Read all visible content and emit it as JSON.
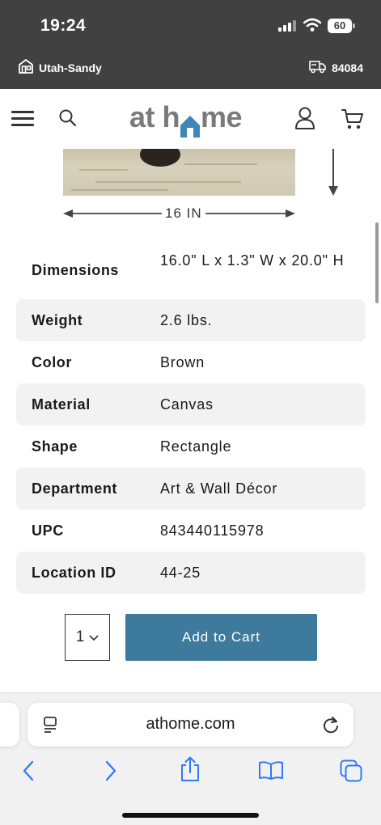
{
  "status_bar": {
    "time": "19:24",
    "battery": "60"
  },
  "store_bar": {
    "location": "Utah-Sandy",
    "zip": "84084"
  },
  "header": {
    "logo_left": "at h",
    "logo_right": "me"
  },
  "product_dims": {
    "width_label": "16 IN"
  },
  "specs": [
    {
      "key": "Dimensions",
      "value": "16.0\" L x 1.3\" W x 20.0\" H"
    },
    {
      "key": "Weight",
      "value": "2.6 lbs."
    },
    {
      "key": "Color",
      "value": "Brown"
    },
    {
      "key": "Material",
      "value": "Canvas"
    },
    {
      "key": "Shape",
      "value": "Rectangle"
    },
    {
      "key": "Department",
      "value": "Art & Wall Décor"
    },
    {
      "key": "UPC",
      "value": "843440115978"
    },
    {
      "key": "Location ID",
      "value": "44-25"
    }
  ],
  "purchase": {
    "quantity": "1",
    "add_to_cart_label": "Add to Cart",
    "button_color": "#3d7a9c"
  },
  "browser": {
    "url": "athome.com"
  },
  "icons": {
    "store": "storefront-icon",
    "delivery": "delivery-truck-icon",
    "menu": "hamburger-menu-icon",
    "search": "search-icon",
    "account": "account-icon",
    "cart": "cart-icon",
    "back": "back-icon",
    "forward": "forward-icon",
    "share": "share-icon",
    "bookmarks": "bookmarks-icon",
    "tabs": "tabs-icon"
  },
  "colors": {
    "top_bar": "#414141",
    "logo_gray": "#7a7a7a",
    "logo_house": "#3d86b8",
    "safari_blue": "#2f7bf6"
  }
}
